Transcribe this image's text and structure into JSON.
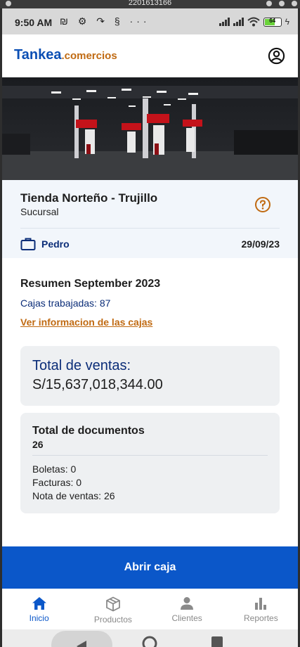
{
  "emulator": {
    "title": "2201613166"
  },
  "status_bar": {
    "time": "9:50 AM",
    "battery_level": "64"
  },
  "app_bar": {
    "brand_main": "Tankea",
    "brand_suffix": ".comercios",
    "brand_color": "#0b4fb4",
    "accent_color": "#c06a12"
  },
  "store": {
    "name": "Tienda Norteño - Trujillo",
    "type": "Sucursal",
    "user": "Pedro",
    "date": "29/09/23"
  },
  "summary": {
    "title": "Resumen September 2023",
    "cash_registers": "Cajas trabajadas: 87",
    "cash_link": "Ver informacion de las cajas"
  },
  "sales": {
    "label": "Total de ventas:",
    "value": "S/15,637,018,344.00"
  },
  "documents": {
    "label": "Total de documentos",
    "total": "26",
    "boletas": "Boletas: 0",
    "facturas": "Facturas: 0",
    "notas": "Nota de ventas: 26"
  },
  "actions": {
    "open_cash": "Abrir caja"
  },
  "nav": {
    "items": [
      {
        "label": "Inicio",
        "icon": "home-icon",
        "active": true
      },
      {
        "label": "Productos",
        "icon": "box-icon",
        "active": false
      },
      {
        "label": "Clientes",
        "icon": "person-icon",
        "active": false
      },
      {
        "label": "Reportes",
        "icon": "bar-chart-icon",
        "active": false
      }
    ]
  }
}
